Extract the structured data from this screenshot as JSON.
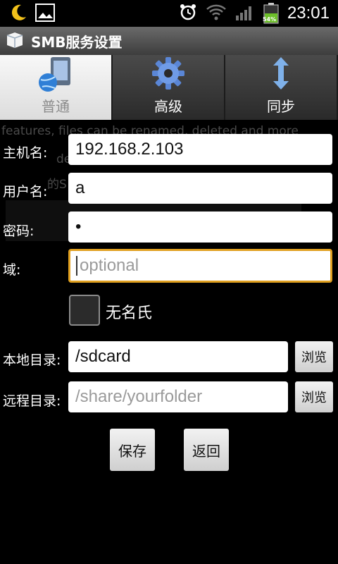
{
  "status_bar": {
    "clock": "23:01",
    "battery_level": "54%",
    "icons": [
      "moon-icon",
      "gallery-icon",
      "alarm-icon",
      "wifi-icon",
      "signal-icon",
      "battery-icon"
    ]
  },
  "app": {
    "title": "SMB服务设置",
    "icon": "app-box-icon"
  },
  "tabs": [
    {
      "label": "普通",
      "icon": "computer-globe-icon",
      "selected": true
    },
    {
      "label": "高级",
      "icon": "gear-icon",
      "selected": false
    },
    {
      "label": "同步",
      "icon": "sync-arrows-icon",
      "selected": false
    }
  ],
  "background_text": {
    "line1": "features, files can be renamed, deleted and more",
    "line2": "de",
    "line3": "的S"
  },
  "form": {
    "host": {
      "label": "主机名:",
      "value": "192.168.2.103"
    },
    "user": {
      "label": "用户名:",
      "value": "a"
    },
    "password": {
      "label": "密码:",
      "value": "•"
    },
    "domain": {
      "label": "域:",
      "value": "",
      "placeholder": "optional"
    },
    "anonymous": {
      "label": "无名氏",
      "checked": false
    },
    "local_dir": {
      "label": "本地目录:",
      "value": "/sdcard",
      "browse": "浏览"
    },
    "remote_dir": {
      "label": "远程目录:",
      "value": "",
      "placeholder": "/share/yourfolder",
      "browse": "浏览"
    }
  },
  "actions": {
    "save": "保存",
    "back": "返回"
  },
  "colors": {
    "focus_border": "#e0a020",
    "battery": "#6dbf2a",
    "titlebar": "#555555"
  }
}
